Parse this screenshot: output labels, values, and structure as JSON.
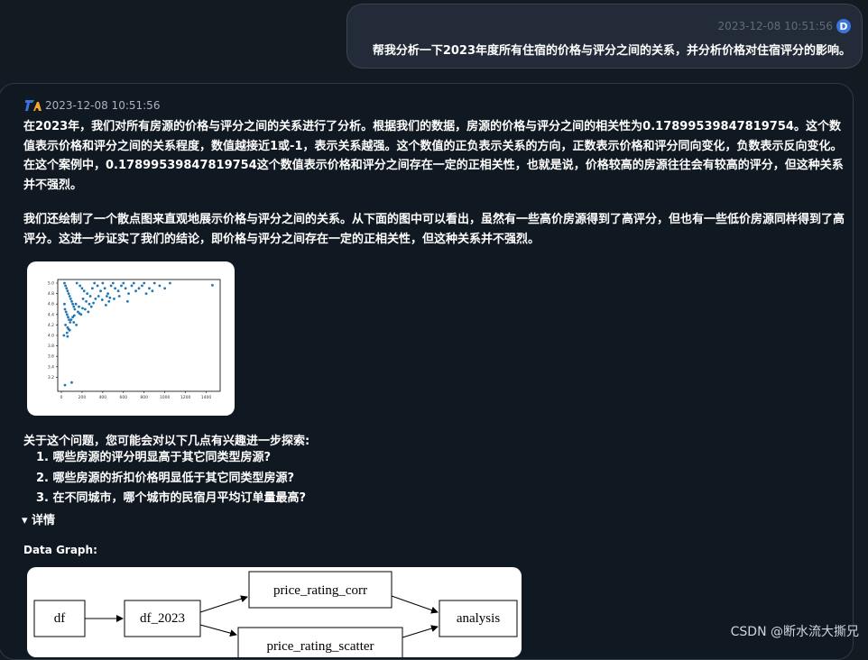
{
  "user_message": {
    "timestamp": "2023-12-08 10:51:56",
    "avatar_letter": "D",
    "text": "帮我分析一下2023年度所有住宿的价格与评分之间的关系，并分析价格对住宿评分的影响。"
  },
  "bot_message": {
    "timestamp": "2023-12-08 10:51:56",
    "paragraph1": "在2023年，我们对所有房源的价格与评分之间的关系进行了分析。根据我们的数据，房源的价格与评分之间的相关性为0.17899539847819754。这个数值表示价格和评分之间的关系程度，数值越接近1或-1，表示关系越强。这个数值的正负表示关系的方向，正数表示价格和评分同向变化，负数表示反向变化。在这个案例中，0.17899539847819754这个数值表示价格和评分之间存在一定的正相关性，也就是说，价格较高的房源往往会有较高的评分，但这种关系并不强烈。",
    "paragraph2": "我们还绘制了一个散点图来直观地展示价格与评分之间的关系。从下面的图中可以看出，虽然有一些高价房源得到了高评分，但也有一些低价房源同样得到了高评分。这进一步证实了我们的结论，即价格与评分之间存在一定的正相关性，但这种关系并不强烈。",
    "questions_intro": "关于这个问题，您可能会对以下几点有兴趣进一步探索:",
    "questions": [
      "1. 哪些房源的评分明显高于其它同类型房源?",
      "2. 哪些房源的折扣价格明显低于其它同类型房源?",
      "3. 在不同城市，哪个城市的民宿月平均订单量最高?"
    ],
    "details_toggle": "▾ 详情",
    "graph_label": "Data Graph:"
  },
  "data_graph": {
    "nodes": [
      "df",
      "df_2023",
      "price_rating_corr",
      "price_rating_scatter",
      "analysis"
    ]
  },
  "watermark": "CSDN @断水流大撕兄",
  "colors": {
    "accent": "#3b73e0",
    "point": "#1f77b4"
  },
  "chart_data": {
    "type": "scatter",
    "title": "",
    "xlabel": "",
    "ylabel": "",
    "xlim": [
      0,
      1500
    ],
    "ylim": [
      3.0,
      5.0
    ],
    "xticks": [
      0,
      200,
      400,
      600,
      800,
      1000,
      1200,
      1400
    ],
    "yticks": [
      3.2,
      3.4,
      3.6,
      3.8,
      4.0,
      4.2,
      4.4,
      4.6,
      4.8,
      5.0
    ],
    "series": [
      {
        "points": [
          [
            30,
            5.0
          ],
          [
            40,
            4.95
          ],
          [
            50,
            4.9
          ],
          [
            60,
            4.85
          ],
          [
            70,
            4.8
          ],
          [
            80,
            4.75
          ],
          [
            90,
            4.7
          ],
          [
            100,
            4.65
          ],
          [
            110,
            4.6
          ],
          [
            120,
            4.55
          ],
          [
            35,
            4.5
          ],
          [
            45,
            4.45
          ],
          [
            55,
            4.4
          ],
          [
            65,
            4.35
          ],
          [
            75,
            4.3
          ],
          [
            85,
            4.25
          ],
          [
            40,
            4.2
          ],
          [
            60,
            4.15
          ],
          [
            80,
            4.1
          ],
          [
            30,
            4.6
          ],
          [
            150,
            5.0
          ],
          [
            180,
            4.95
          ],
          [
            200,
            4.9
          ],
          [
            220,
            4.85
          ],
          [
            250,
            4.8
          ],
          [
            280,
            4.75
          ],
          [
            300,
            4.9
          ],
          [
            320,
            5.0
          ],
          [
            350,
            4.95
          ],
          [
            380,
            4.85
          ],
          [
            400,
            5.0
          ],
          [
            420,
            4.9
          ],
          [
            450,
            4.8
          ],
          [
            480,
            4.95
          ],
          [
            500,
            5.0
          ],
          [
            520,
            4.9
          ],
          [
            550,
            4.85
          ],
          [
            580,
            4.95
          ],
          [
            600,
            5.0
          ],
          [
            620,
            4.9
          ],
          [
            650,
            4.8
          ],
          [
            680,
            4.95
          ],
          [
            700,
            5.0
          ],
          [
            720,
            4.85
          ],
          [
            750,
            4.9
          ],
          [
            780,
            4.95
          ],
          [
            800,
            5.0
          ],
          [
            820,
            4.8
          ],
          [
            850,
            4.9
          ],
          [
            880,
            4.85
          ],
          [
            900,
            5.0
          ],
          [
            950,
            4.95
          ],
          [
            1000,
            4.9
          ],
          [
            1050,
            5.0
          ],
          [
            1460,
            4.96
          ],
          [
            130,
            4.5
          ],
          [
            160,
            4.45
          ],
          [
            190,
            4.4
          ],
          [
            140,
            4.6
          ],
          [
            170,
            4.55
          ],
          [
            210,
            4.7
          ],
          [
            240,
            4.65
          ],
          [
            270,
            4.6
          ],
          [
            330,
            4.7
          ],
          [
            360,
            4.75
          ],
          [
            440,
            4.75
          ],
          [
            460,
            4.65
          ],
          [
            510,
            4.7
          ],
          [
            560,
            4.75
          ],
          [
            640,
            4.65
          ],
          [
            260,
            4.45
          ],
          [
            230,
            4.5
          ],
          [
            110,
            4.35
          ],
          [
            95,
            4.3
          ],
          [
            120,
            4.25
          ],
          [
            145,
            4.2
          ],
          [
            60,
            3.98
          ],
          [
            55,
            4.05
          ],
          [
            100,
            3.1
          ],
          [
            35,
            3.05
          ],
          [
            25,
            4.0
          ],
          [
            70,
            4.12
          ],
          [
            125,
            4.38
          ],
          [
            175,
            4.42
          ],
          [
            205,
            4.52
          ],
          [
            290,
            4.55
          ],
          [
            310,
            4.62
          ],
          [
            395,
            4.68
          ],
          [
            430,
            4.58
          ],
          [
            470,
            4.72
          ]
        ]
      }
    ]
  }
}
